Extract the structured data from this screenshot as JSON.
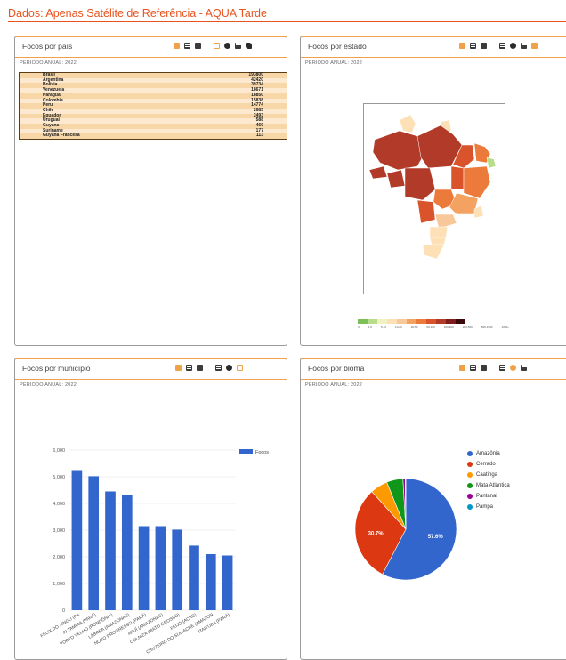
{
  "page": {
    "title": "Dados: Apenas Satélite de Referência - AQUA Tarde"
  },
  "colors": {
    "accent": "#e8531e",
    "panel_border_top": "#f0a24a",
    "bar": "#3366cc"
  },
  "panels": {
    "country": {
      "title": "Focos por país",
      "period": "PERÍODO ANUAL: 2022",
      "icons": [
        "download-icon",
        "table-icon",
        "save-icon",
        "grid-icon",
        "pie-chart-icon",
        "bar-chart-icon",
        "map-icon"
      ],
      "rows": [
        {
          "name": "Brasil",
          "value": "193800"
        },
        {
          "name": "Argentina",
          "value": "42420"
        },
        {
          "name": "Bolívia",
          "value": "39734"
        },
        {
          "name": "Venezuela",
          "value": "18671"
        },
        {
          "name": "Paraguai",
          "value": "18850"
        },
        {
          "name": "Colombia",
          "value": "15838"
        },
        {
          "name": "Peru",
          "value": "14774"
        },
        {
          "name": "Chile",
          "value": "2685"
        },
        {
          "name": "Equador",
          "value": "2493"
        },
        {
          "name": "Uruguai",
          "value": "588"
        },
        {
          "name": "Guyana",
          "value": "469"
        },
        {
          "name": "Suriname",
          "value": "177"
        },
        {
          "name": "Guyana Francesa",
          "value": "113"
        }
      ]
    },
    "state": {
      "title": "Focos por estado",
      "period": "PERÍODO ANUAL: 2022",
      "icons": [
        "download-icon",
        "table-icon",
        "save-icon",
        "grid-icon",
        "pie-chart-icon",
        "bar-chart-icon",
        "map-icon"
      ],
      "legend_colors": [
        "#7fbf5a",
        "#b6de8a",
        "#f1f1c4",
        "#fde0b5",
        "#f9c89a",
        "#f4a261",
        "#ec7a3a",
        "#d9532b",
        "#b23a28",
        "#7f1d1d",
        "#3a0a0a"
      ],
      "legend_labels": [
        "0",
        "1-5",
        "5-10",
        "10-20",
        "20-50",
        "50-100",
        "100-200",
        "200-500",
        "500-1000",
        "1000+",
        ""
      ]
    },
    "municipio": {
      "title": "Focos por município",
      "period": "PERÍODO ANUAL: 2022",
      "icons": [
        "download-icon",
        "table-icon",
        "save-icon",
        "grid-icon",
        "pie-chart-icon",
        "bar-chart-icon"
      ]
    },
    "bioma": {
      "title": "Focos por bioma",
      "period": "PERÍODO ANUAL: 2022",
      "icons": [
        "download-icon",
        "table-icon",
        "save-icon",
        "grid-icon",
        "pie-chart-icon",
        "bar-chart-icon"
      ]
    }
  },
  "chart_data": [
    {
      "type": "bar",
      "title": "",
      "legend": [
        "Focos"
      ],
      "legend_position": "top-right",
      "categories": [
        "FELIX DO XINGU (PA",
        "ALTAMIRA (PARÁ)",
        "PORTO VELHO (RONDÔNIA)",
        "LÁBREA (AMAZONAS)",
        "NOVO PROGRESSO (PARÁ)",
        "APUÍ (AMAZONAS)",
        "COLNIZA (MATO GROSSO)",
        "FEIJÓ (ACRE)",
        "CRUZEIRO DO SUL/ACRE (AMAZON",
        "ITAITUBA (PARÁ)"
      ],
      "values": [
        5250,
        5020,
        4450,
        4300,
        3150,
        3150,
        3020,
        2420,
        2100,
        2050
      ],
      "ylim": [
        0,
        6000
      ],
      "yticks": [
        "0",
        "1,000",
        "2,000",
        "3,000",
        "4,000",
        "5,000",
        "6,000"
      ]
    },
    {
      "type": "pie",
      "title": "",
      "legend_position": "right",
      "slices": [
        {
          "label": "Amazônia",
          "value": 57.6,
          "color": "#3366cc",
          "shown": "57.6%"
        },
        {
          "label": "Cerrado",
          "value": 30.7,
          "color": "#dc3912",
          "shown": "30.7%"
        },
        {
          "label": "Caatinga",
          "value": 5.6,
          "color": "#ff9900",
          "shown": ""
        },
        {
          "label": "Mata Atlântica",
          "value": 5.2,
          "color": "#109618",
          "shown": ""
        },
        {
          "label": "Pantanal",
          "value": 0.7,
          "color": "#990099",
          "shown": ""
        },
        {
          "label": "Pampa",
          "value": 0.2,
          "color": "#0099c6",
          "shown": ""
        }
      ]
    }
  ]
}
